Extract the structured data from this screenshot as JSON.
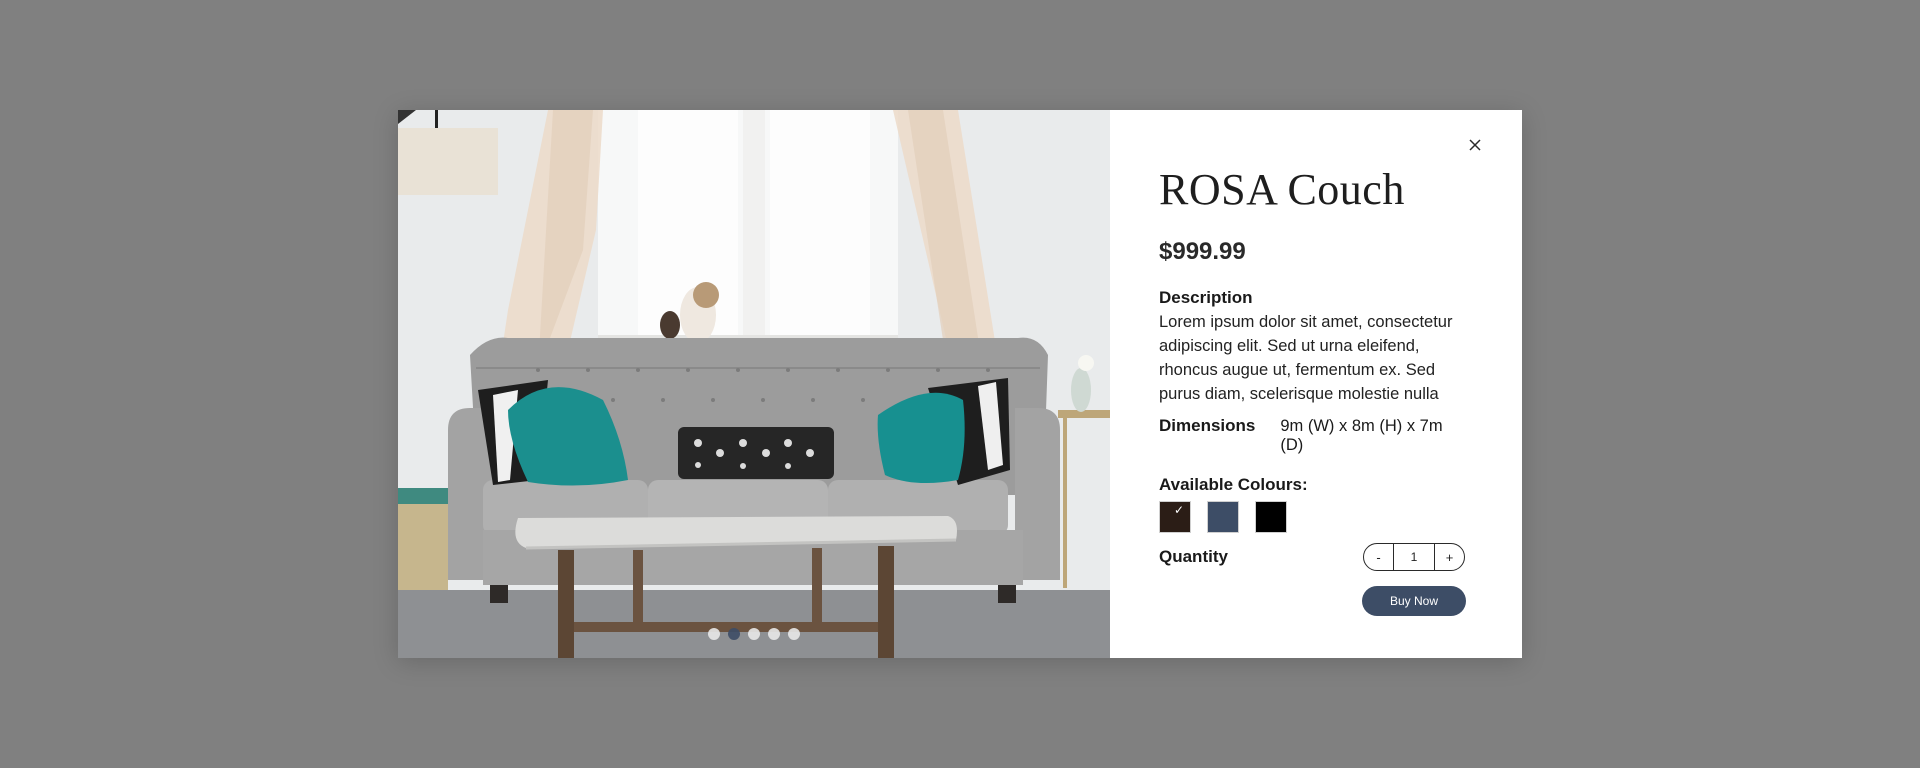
{
  "product": {
    "title": "ROSA Couch",
    "price": "$999.99",
    "description_label": "Description",
    "description": "Lorem ipsum dolor sit amet, consectetur adipiscing elit. Sed ut urna eleifend, rhoncus augue ut, fermentum ex. Sed purus diam, scelerisque molestie nulla nec,",
    "dimensions_label": "Dimensions",
    "dimensions": "9m (W) x 8m (H) x 7m (D)",
    "colours_label": "Available Colours:",
    "colours": [
      {
        "name": "brown",
        "hex": "#2b1d16",
        "selected": true
      },
      {
        "name": "slate-blue",
        "hex": "#3d4d66",
        "selected": false
      },
      {
        "name": "black",
        "hex": "#000000",
        "selected": false
      }
    ],
    "quantity_label": "Quantity",
    "quantity": "1",
    "minus_label": "-",
    "plus_label": "+",
    "buy_label": "Buy Now",
    "selected_check": "✓"
  },
  "carousel": {
    "slides": 5,
    "active_index": 1
  },
  "colors": {
    "overlay": "#808080",
    "accent": "#3d4d66"
  },
  "icons": {
    "close": "close-icon",
    "check": "check-icon"
  }
}
